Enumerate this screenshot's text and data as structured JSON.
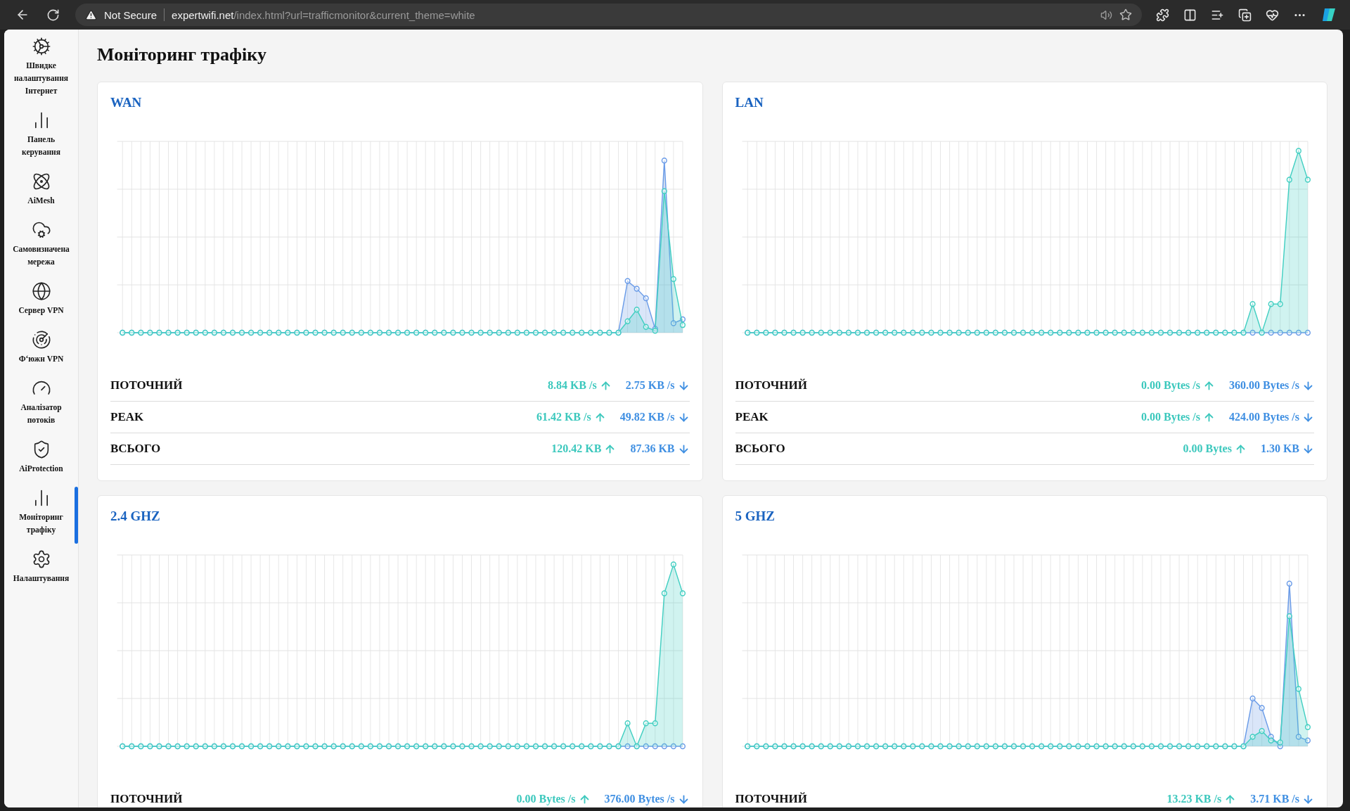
{
  "browser": {
    "security": "Not Secure",
    "host": "expertwifi.net",
    "path": "/index.html?url=trafficmonitor&current_theme=white"
  },
  "sidebar": {
    "items": [
      {
        "label": "Швидке налаштування Інтернет",
        "selected": false
      },
      {
        "label": "Панель керування",
        "selected": false
      },
      {
        "label": "AiMesh",
        "selected": false
      },
      {
        "label": "Самовизначена мережа",
        "selected": false
      },
      {
        "label": "Сервер VPN",
        "selected": false
      },
      {
        "label": "Ф‘южн VPN",
        "selected": false
      },
      {
        "label": "Аналізатор потоків",
        "selected": false
      },
      {
        "label": "AiProtection",
        "selected": false
      },
      {
        "label": "Моніторинг трафіку",
        "selected": true
      },
      {
        "label": "Налаштування",
        "selected": false
      }
    ]
  },
  "page_title": "Моніторинг трафіку",
  "cards": [
    {
      "title": "WAN",
      "rows": [
        {
          "label": "ПОТОЧНИЙ",
          "up": "8.84 KB /s",
          "down": "2.75 KB /s"
        },
        {
          "label": "PEAK",
          "up": "61.42 KB /s",
          "down": "49.82 KB /s"
        },
        {
          "label": "ВСЬОГО",
          "up": "120.42 KB",
          "down": "87.36 KB"
        }
      ]
    },
    {
      "title": "LAN",
      "rows": [
        {
          "label": "ПОТОЧНИЙ",
          "up": "0.00 Bytes /s",
          "down": "360.00 Bytes /s"
        },
        {
          "label": "PEAK",
          "up": "0.00 Bytes /s",
          "down": "424.00 Bytes /s"
        },
        {
          "label": "ВСЬОГО",
          "up": "0.00 Bytes",
          "down": "1.30 KB"
        }
      ]
    },
    {
      "title": "2.4 GHZ",
      "rows": [
        {
          "label": "ПОТОЧНИЙ",
          "up": "0.00 Bytes /s",
          "down": "376.00 Bytes /s"
        }
      ]
    },
    {
      "title": "5 GHZ",
      "rows": [
        {
          "label": "ПОТОЧНИЙ",
          "up": "13.23 KB /s",
          "down": "3.71 KB /s"
        }
      ]
    }
  ]
}
